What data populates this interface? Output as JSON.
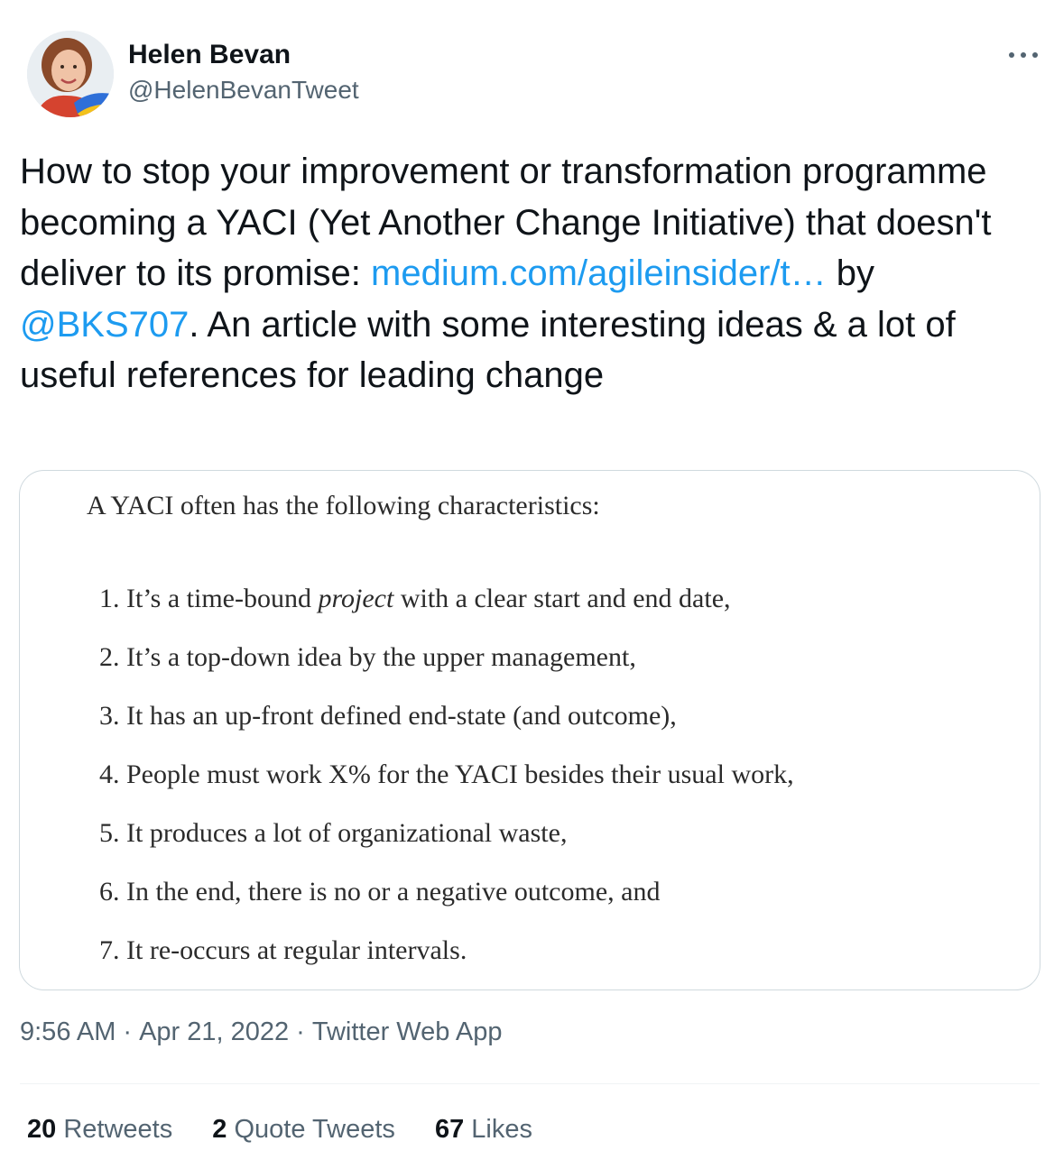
{
  "author": {
    "display_name": "Helen Bevan",
    "handle": "@HelenBevanTweet"
  },
  "tweet": {
    "text_before_link": "How to stop your improvement or transformation programme becoming a YACI (Yet Another Change Initiative) that doesn't deliver to its promise: ",
    "link_text": "medium.com/agileinsider/t…",
    "text_by": " by ",
    "mention": "@BKS707",
    "text_after": ". An article with some interesting ideas & a lot of useful references for leading change"
  },
  "card": {
    "intro": "A YACI often has the following characteristics:",
    "items": [
      {
        "prefix": "1. It’s a time-bound ",
        "emphasis": "project",
        "suffix": " with a clear start and end date,"
      },
      {
        "prefix": "2. It’s a top-down idea by the upper management,",
        "emphasis": "",
        "suffix": ""
      },
      {
        "prefix": "3. It has an up-front defined end-state (and outcome),",
        "emphasis": "",
        "suffix": ""
      },
      {
        "prefix": "4. People must work X% for the YACI besides their usual work,",
        "emphasis": "",
        "suffix": ""
      },
      {
        "prefix": "5. It produces a lot of organizational waste,",
        "emphasis": "",
        "suffix": ""
      },
      {
        "prefix": "6. In the end, there is no or a negative outcome, and",
        "emphasis": "",
        "suffix": ""
      },
      {
        "prefix": "7. It re-occurs at regular intervals.",
        "emphasis": "",
        "suffix": ""
      }
    ]
  },
  "meta": {
    "time": "9:56 AM",
    "separator": "·",
    "date": "Apr 21, 2022",
    "source": "Twitter Web App"
  },
  "stats": {
    "retweets_count": "20",
    "retweets_label": "Retweets",
    "quotes_count": "2",
    "quotes_label": "Quote Tweets",
    "likes_count": "67",
    "likes_label": "Likes"
  },
  "colors": {
    "link": "#1d9bf0",
    "secondary_text": "#536471",
    "primary_text": "#0f1419",
    "border": "#cfd9de"
  },
  "icons": {
    "more": "more-horizontal-icon"
  }
}
